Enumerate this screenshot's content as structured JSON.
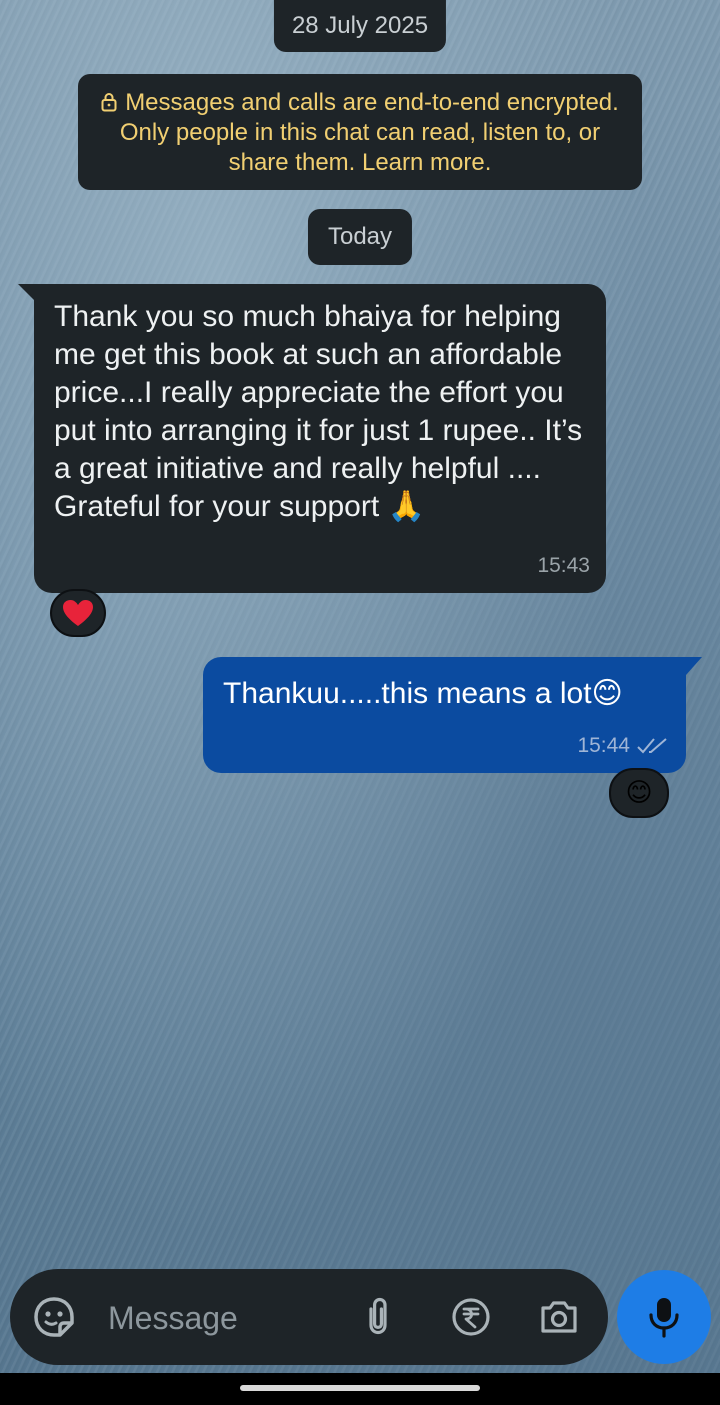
{
  "chat": {
    "date_label": "28 July 2025",
    "encryption_notice": "Messages and calls are end-to-end encrypted. Only people in this chat can read, listen to, or share them. Learn more.",
    "today_label": "Today",
    "messages": [
      {
        "direction": "incoming",
        "text": "Thank you so much bhaiya for helping me get this book at such an affordable price...I really appreciate the effort you put into arranging it for just 1 rupee.. It’s a great initiative and really helpful .... Grateful for your support 🙏",
        "time": "15:43",
        "reaction": "❤️"
      },
      {
        "direction": "outgoing",
        "text": "Thankuu.....this means a lot😊",
        "time": "15:44",
        "status": "read",
        "reaction": "😊"
      }
    ]
  },
  "composer": {
    "placeholder": "Message",
    "icons": [
      "sticker-icon",
      "attach-icon",
      "rupee-payment-icon",
      "camera-icon"
    ],
    "mic_icon": "microphone-icon"
  },
  "colors": {
    "incoming_bubble": "#1e2428",
    "outgoing_bubble": "#0b4ba0",
    "notice_text": "#f1cf72",
    "mic_button": "#1e7de6"
  }
}
